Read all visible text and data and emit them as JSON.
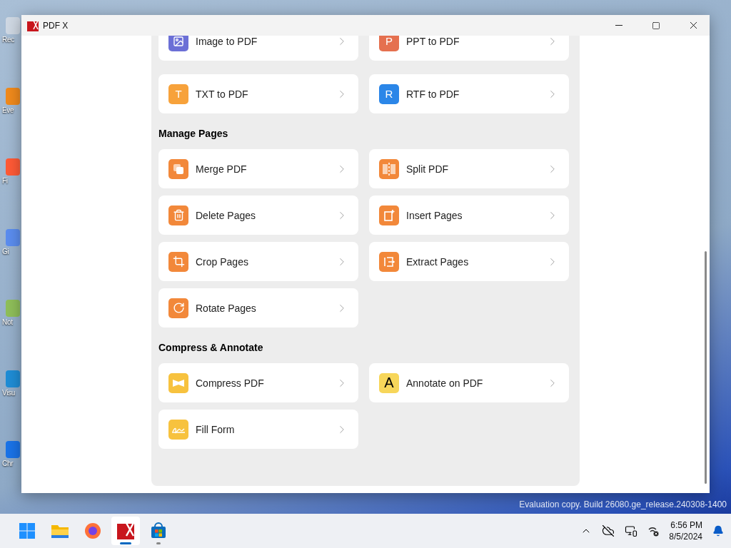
{
  "desktop_icons": [
    {
      "label": "Rec"
    },
    {
      "label": "Eve"
    },
    {
      "label": "Fi"
    },
    {
      "label": "Gi"
    },
    {
      "label": "Not"
    },
    {
      "label": "Visu"
    },
    {
      "label": "Chr"
    }
  ],
  "window": {
    "title": "PDF X"
  },
  "sections": [
    {
      "tools": [
        {
          "label": "Image to PDF",
          "kind": "image",
          "color": "#6b6fd6"
        },
        {
          "label": "PPT to PDF",
          "kind": "letter",
          "glyph": "P",
          "color": "#e5704f"
        },
        {
          "label": "TXT to PDF",
          "kind": "letter",
          "glyph": "T",
          "color": "#f7a23b"
        },
        {
          "label": "RTF to PDF",
          "kind": "letter",
          "glyph": "R",
          "color": "#2b86e8"
        }
      ]
    },
    {
      "heading": "Manage Pages",
      "tools": [
        {
          "label": "Merge PDF",
          "kind": "merge",
          "color": "#f2883a"
        },
        {
          "label": "Split PDF",
          "kind": "split",
          "color": "#f2883a"
        },
        {
          "label": "Delete Pages",
          "kind": "delete",
          "color": "#f2883a"
        },
        {
          "label": "Insert Pages",
          "kind": "insert",
          "color": "#f2883a"
        },
        {
          "label": "Crop Pages",
          "kind": "crop",
          "color": "#f2883a"
        },
        {
          "label": "Extract Pages",
          "kind": "extract",
          "color": "#f2883a"
        },
        {
          "label": "Rotate Pages",
          "kind": "rotate",
          "color": "#f2883a"
        }
      ]
    },
    {
      "heading": "Compress & Annotate",
      "tools": [
        {
          "label": "Compress PDF",
          "kind": "compress",
          "color": "#f7c23e"
        },
        {
          "label": "Annotate on PDF",
          "kind": "annotate",
          "glyph": "A",
          "color": "#f7d65a"
        },
        {
          "label": "Fill Form",
          "kind": "fill",
          "color": "#f7c23e"
        }
      ]
    }
  ],
  "watermark": "Evaluation copy. Build 26080.ge_release.240308-1400",
  "taskbar": {
    "apps": [
      {
        "kind": "start",
        "selected": false,
        "running": false
      },
      {
        "kind": "explorer",
        "selected": false,
        "running": false
      },
      {
        "kind": "firefox",
        "selected": false,
        "running": false
      },
      {
        "kind": "pdfx",
        "selected": true,
        "running": true
      },
      {
        "kind": "store",
        "selected": false,
        "running": true
      }
    ],
    "time": "6:56 PM",
    "date": "8/5/2024"
  }
}
